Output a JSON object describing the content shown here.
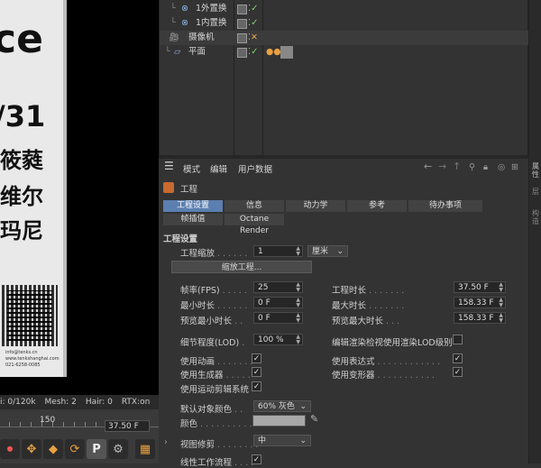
{
  "viewport": {
    "poster": {
      "big_text": "ce",
      "date_text": "/31",
      "line1": "筱蕤",
      "line2": "维尔",
      "line3": "玛尼",
      "qr_caption1": "info@tenks.cn",
      "qr_caption2": "www.tenkshanghai.com",
      "qr_caption3": "021-6258-0085"
    }
  },
  "statusbar": {
    "poly": "i: 0/120k",
    "mesh": "Mesh: 2",
    "hair": "Hair: 0",
    "rtx": "RTX:on"
  },
  "timeline": {
    "ruler_label": "150",
    "frame_value": "37.50 F",
    "buttons": [
      "record-icon",
      "move-icon",
      "key-icon",
      "autokey-icon",
      "p-key-icon",
      "film-icon"
    ]
  },
  "object_manager": {
    "objects": [
      {
        "name": "1外置换",
        "icon": "displacer-icon"
      },
      {
        "name": "1内置换",
        "icon": "displacer-icon"
      },
      {
        "name": "摄像机",
        "icon": "camera-icon"
      },
      {
        "name": "平面",
        "icon": "plane-icon"
      }
    ]
  },
  "attribute_manager": {
    "menu": {
      "mode": "模式",
      "edit": "编辑",
      "user_data": "用户数据"
    },
    "object_title": "工程",
    "tabs_row1": [
      {
        "label": "工程设置",
        "active": true
      },
      {
        "label": "信息",
        "active": false
      },
      {
        "label": "动力学",
        "active": false
      },
      {
        "label": "参考",
        "active": false
      },
      {
        "label": "待办事项",
        "active": false
      }
    ],
    "tabs_row2": [
      {
        "label": "帧插值",
        "active": false
      },
      {
        "label": "Octane Render",
        "active": false
      }
    ],
    "section_title": "工程设置",
    "scale_label": "工程缩放",
    "scale_value": "1",
    "scale_unit": "厘米",
    "scale_button": "缩放工程...",
    "fps_label": "帧率(FPS)",
    "fps_value": "25",
    "duration_label": "工程时长",
    "duration_value": "37.50 F",
    "min_time_label": "最小时长",
    "min_time_value": "0 F",
    "max_time_label": "最大时长",
    "max_time_value": "158.33 F",
    "preview_min_label": "预览最小时长",
    "preview_min_value": "0 F",
    "preview_max_label": "预览最大时长",
    "preview_max_value": "158.33 F",
    "lod_label": "细节程度(LOD)",
    "lod_value": "100 %",
    "render_lod_label": "编辑渲染检视使用渲染LOD级别",
    "use_animation_label": "使用动画",
    "use_expression_label": "使用表达式",
    "use_generator_label": "使用生成器",
    "use_deformer_label": "使用变形器",
    "use_motion_label": "使用运动剪辑系统",
    "default_color_label": "默认对象颜色",
    "default_color_value": "60% 灰色",
    "color_label": "颜色",
    "color_swatch": "#a8a8a8",
    "view_clip_label": "视图修剪",
    "view_clip_value": "中",
    "linear_workflow_label": "线性工作流程"
  },
  "right_strip": {
    "labels": [
      "属性",
      "层",
      "构造"
    ]
  }
}
